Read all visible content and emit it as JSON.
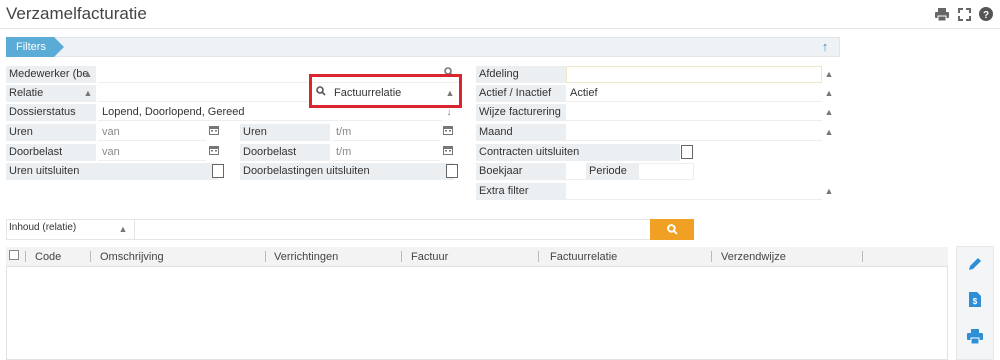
{
  "page": {
    "title": "Verzamelfacturatie"
  },
  "top_icons": [
    "print-icon",
    "expand-icon",
    "help-icon"
  ],
  "filters": {
    "tab_label": "Filters",
    "left": {
      "medewerker_label": "Medewerker (be",
      "relatie_label": "Relatie",
      "dossierstatus_label": "Dossierstatus",
      "dossierstatus_value": "Lopend, Doorlopend, Gereed",
      "uren_label": "Uren",
      "uren_van": "van",
      "doorbelast_label": "Doorbelast",
      "doorbelast_van": "van",
      "uren_uitsluiten_label": "Uren uitsluiten"
    },
    "middle": {
      "factuurrelatie_value": "Factuurrelatie",
      "uren_label": "Uren",
      "uren_tm": "t/m",
      "doorbelast_label": "Doorbelast",
      "doorbelast_tm": "t/m",
      "doorbelastingen_uitsluiten_label": "Doorbelastingen uitsluiten"
    },
    "right": {
      "afdeling_label": "Afdeling",
      "actief_label": "Actief / Inactief",
      "actief_value": "Actief",
      "wijze_label": "Wijze facturering",
      "maand_label": "Maand",
      "contracten_label": "Contracten uitsluiten",
      "boekjaar_label": "Boekjaar",
      "periode_label": "Periode",
      "extra_label": "Extra filter"
    }
  },
  "search": {
    "scope_value": "Inhoud (relatie)"
  },
  "table": {
    "columns": [
      "Code",
      "Omschrijving",
      "Verrichtingen",
      "Factuur",
      "Factuurrelatie",
      "Verzendwijze"
    ]
  },
  "side_actions": [
    "edit-icon",
    "invoice-icon",
    "print-icon"
  ],
  "colors": {
    "accent": "#5aabd6",
    "search_button": "#f0a023",
    "highlight_box": "#d9262c",
    "icon_blue": "#2f8fd6"
  }
}
